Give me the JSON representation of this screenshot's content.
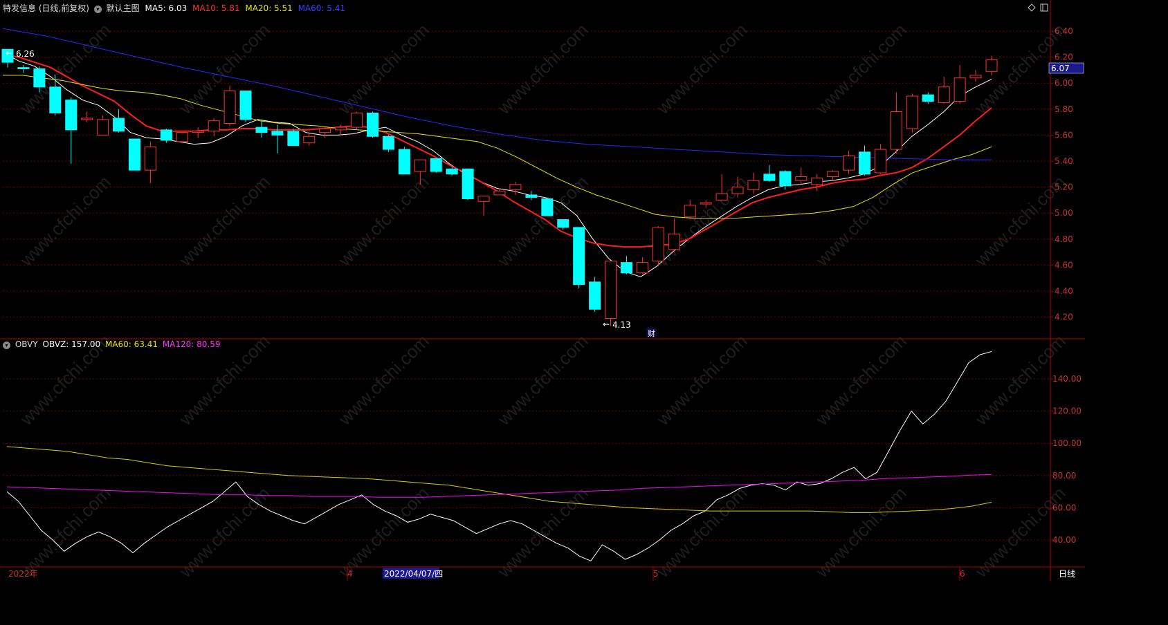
{
  "colors": {
    "up": "#ff3232",
    "down": "#00ffff",
    "ma5": "#ffffff",
    "ma10": "#ff1e1e",
    "ma20": "#e6e600",
    "ma60": "#2828ff",
    "grid": "#7a0000",
    "border": "#b40000",
    "obv": "#ffffff",
    "obv_ma60": "#d2d200",
    "obv_ma120": "#ff00ff"
  },
  "header": {
    "title": "特发信息 (日线,前复权)",
    "indicator_label": "默认主图",
    "ma5": "MA5: 6.03",
    "ma10": "MA10: 5.81",
    "ma20": "MA20: 5.51",
    "ma60": "MA60: 5.41"
  },
  "sub_header": {
    "title": "OBVY",
    "obvz": "OBVZ: 157.00",
    "ma60": "MA60: 63.41",
    "ma120": "MA120: 80.59"
  },
  "price_axis_labels": [
    "6.40",
    "6.20",
    "6.00",
    "5.80",
    "5.60",
    "5.40",
    "5.20",
    "5.00",
    "4.80",
    "4.60",
    "4.40",
    "4.20"
  ],
  "obv_axis_labels": [
    "140.00",
    "120.00",
    "100.00",
    "80.00",
    "60.00",
    "40.00"
  ],
  "last_price_tag": "6.07",
  "high_label": "6.26",
  "low_label": "4.13",
  "event_marker": "财",
  "x_labels": {
    "start": "2022年",
    "apr": "4",
    "cursor_date": "2022/04/07/四",
    "may": "5",
    "jun": "6"
  },
  "period_button": "日线",
  "watermark": "www.cfchi.com",
  "chart_data": [
    {
      "type": "candlestick",
      "title": "特发信息 (日线,前复权)",
      "ylim": [
        4.1,
        6.5
      ],
      "series_order": [
        "open",
        "close",
        "high",
        "low"
      ],
      "candles": [
        [
          6.26,
          6.16,
          6.26,
          6.12
        ],
        [
          6.12,
          6.11,
          6.14,
          6.08
        ],
        [
          6.11,
          5.97,
          6.13,
          5.93
        ],
        [
          5.97,
          5.77,
          6.06,
          5.75
        ],
        [
          5.87,
          5.64,
          5.89,
          5.38
        ],
        [
          5.72,
          5.73,
          5.78,
          5.7
        ],
        [
          5.6,
          5.72,
          5.75,
          5.6
        ],
        [
          5.73,
          5.63,
          5.8,
          5.62
        ],
        [
          5.57,
          5.33,
          5.57,
          5.33
        ],
        [
          5.33,
          5.51,
          5.55,
          5.23
        ],
        [
          5.64,
          5.56,
          5.65,
          5.54
        ],
        [
          5.55,
          5.62,
          5.62,
          5.55
        ],
        [
          5.62,
          5.63,
          5.66,
          5.58
        ],
        [
          5.63,
          5.71,
          5.73,
          5.59
        ],
        [
          5.69,
          5.94,
          5.98,
          5.67
        ],
        [
          5.94,
          5.72,
          5.94,
          5.7
        ],
        [
          5.66,
          5.62,
          5.72,
          5.58
        ],
        [
          5.63,
          5.6,
          5.68,
          5.46
        ],
        [
          5.63,
          5.52,
          5.65,
          5.52
        ],
        [
          5.54,
          5.59,
          5.61,
          5.52
        ],
        [
          5.62,
          5.65,
          5.66,
          5.58
        ],
        [
          5.64,
          5.66,
          5.68,
          5.6
        ],
        [
          5.66,
          5.77,
          5.78,
          5.64
        ],
        [
          5.77,
          5.59,
          5.78,
          5.58
        ],
        [
          5.59,
          5.49,
          5.6,
          5.47
        ],
        [
          5.49,
          5.3,
          5.51,
          5.3
        ],
        [
          5.32,
          5.41,
          5.41,
          5.22
        ],
        [
          5.42,
          5.32,
          5.42,
          5.31
        ],
        [
          5.34,
          5.3,
          5.36,
          5.29
        ],
        [
          5.34,
          5.11,
          5.34,
          5.1
        ],
        [
          5.09,
          5.13,
          5.13,
          4.98
        ],
        [
          5.14,
          5.17,
          5.19,
          5.14
        ],
        [
          5.18,
          5.22,
          5.24,
          5.14
        ],
        [
          5.14,
          5.12,
          5.17,
          5.1
        ],
        [
          5.11,
          4.98,
          5.12,
          4.98
        ],
        [
          4.95,
          4.89,
          4.95,
          4.87
        ],
        [
          4.89,
          4.45,
          4.89,
          4.42
        ],
        [
          4.47,
          4.26,
          4.51,
          4.24
        ],
        [
          4.19,
          4.63,
          4.63,
          4.13
        ],
        [
          4.62,
          4.54,
          4.67,
          4.53
        ],
        [
          4.54,
          4.62,
          4.66,
          4.53
        ],
        [
          4.63,
          4.89,
          4.9,
          4.59
        ],
        [
          4.72,
          4.84,
          4.96,
          4.7
        ],
        [
          4.97,
          5.06,
          5.1,
          4.95
        ],
        [
          5.07,
          5.08,
          5.1,
          5.04
        ],
        [
          5.1,
          5.15,
          5.3,
          5.1
        ],
        [
          5.15,
          5.2,
          5.28,
          5.12
        ],
        [
          5.18,
          5.25,
          5.31,
          5.15
        ],
        [
          5.3,
          5.25,
          5.37,
          5.24
        ],
        [
          5.32,
          5.21,
          5.33,
          5.18
        ],
        [
          5.25,
          5.28,
          5.35,
          5.22
        ],
        [
          5.22,
          5.27,
          5.3,
          5.17
        ],
        [
          5.28,
          5.32,
          5.33,
          5.25
        ],
        [
          5.33,
          5.44,
          5.48,
          5.3
        ],
        [
          5.47,
          5.3,
          5.52,
          5.29
        ],
        [
          5.31,
          5.49,
          5.53,
          5.3
        ],
        [
          5.49,
          5.78,
          5.93,
          5.46
        ],
        [
          5.65,
          5.9,
          5.92,
          5.62
        ],
        [
          5.91,
          5.86,
          5.93,
          5.84
        ],
        [
          5.85,
          5.97,
          6.05,
          5.84
        ],
        [
          5.86,
          6.04,
          6.14,
          5.84
        ],
        [
          6.04,
          6.06,
          6.1,
          6.01
        ],
        [
          6.09,
          6.18,
          6.21,
          6.06
        ]
      ],
      "series": [
        {
          "name": "MA5",
          "values": [
            6.24,
            6.17,
            6.13,
            6.05,
            5.95,
            5.87,
            5.83,
            5.74,
            5.62,
            5.58,
            5.57,
            5.55,
            5.53,
            5.54,
            5.59,
            5.67,
            5.72,
            5.7,
            5.69,
            5.62,
            5.6,
            5.6,
            5.61,
            5.64,
            5.66,
            5.6,
            5.55,
            5.48,
            5.38,
            5.3,
            5.24,
            5.19,
            5.17,
            5.14,
            5.12,
            5.08,
            4.98,
            4.8,
            4.65,
            4.55,
            4.51,
            4.59,
            4.7,
            4.8,
            4.89,
            4.97,
            5.05,
            5.12,
            5.18,
            5.21,
            5.22,
            5.24,
            5.25,
            5.27,
            5.3,
            5.36,
            5.47,
            5.59,
            5.68,
            5.78,
            5.9,
            5.97,
            6.03
          ]
        },
        {
          "name": "MA10",
          "values": [
            6.22,
            6.2,
            6.16,
            6.12,
            6.05,
            5.98,
            5.92,
            5.86,
            5.76,
            5.67,
            5.63,
            5.63,
            5.63,
            5.64,
            5.64,
            5.65,
            5.65,
            5.64,
            5.64,
            5.64,
            5.65,
            5.66,
            5.67,
            5.66,
            5.62,
            5.56,
            5.5,
            5.44,
            5.37,
            5.31,
            5.24,
            5.17,
            5.09,
            5.02,
            4.95,
            4.86,
            4.81,
            4.77,
            4.75,
            4.74,
            4.74,
            4.75,
            4.76,
            4.8,
            4.87,
            4.94,
            5.01,
            5.08,
            5.12,
            5.15,
            5.18,
            5.2,
            5.23,
            5.25,
            5.26,
            5.29,
            5.31,
            5.35,
            5.42,
            5.51,
            5.6,
            5.71,
            5.81
          ]
        },
        {
          "name": "MA20",
          "values": [
            6.06,
            6.06,
            6.04,
            6.02,
            5.99,
            5.96,
            5.94,
            5.93,
            5.91,
            5.88,
            5.83,
            5.79,
            5.75,
            5.71,
            5.69,
            5.68,
            5.67,
            5.65,
            5.64,
            5.63,
            5.62,
            5.61,
            5.59,
            5.57,
            5.55,
            5.5,
            5.43,
            5.35,
            5.27,
            5.2,
            5.14,
            5.09,
            5.04,
            4.99,
            4.97,
            4.96,
            4.96,
            4.96,
            4.97,
            4.98,
            4.99,
            5.0,
            5.02,
            5.05,
            5.12,
            5.22,
            5.31,
            5.36,
            5.41,
            5.45,
            5.51
          ]
        },
        {
          "name": "MA60",
          "values": [
            6.42,
            6.36,
            6.28,
            6.2,
            6.12,
            6.05,
            5.98,
            5.9,
            5.82,
            5.74,
            5.67,
            5.61,
            5.56,
            5.53,
            5.51,
            5.49,
            5.47,
            5.45,
            5.44,
            5.43,
            5.42,
            5.41,
            5.41
          ]
        }
      ]
    },
    {
      "type": "line",
      "title": "OBVY",
      "ylim": [
        33,
        160
      ],
      "series": [
        {
          "name": "OBVZ",
          "values": [
            70,
            64,
            55,
            46,
            40,
            33,
            38,
            42,
            45,
            42,
            38,
            32,
            38,
            43,
            48,
            52,
            56,
            60,
            64,
            70,
            76,
            67,
            62,
            58,
            55,
            52,
            50,
            54,
            58,
            62,
            65,
            68,
            62,
            58,
            55,
            51,
            53,
            56,
            54,
            52,
            48,
            44,
            47,
            50,
            52,
            50,
            46,
            42,
            38,
            35,
            30,
            27,
            37,
            33,
            28,
            31,
            35,
            40,
            46,
            50,
            55,
            58,
            65,
            68,
            72,
            74,
            75,
            74,
            71,
            76,
            74,
            75,
            78,
            82,
            85,
            78,
            82,
            95,
            108,
            120,
            112,
            118,
            126,
            138,
            150,
            155,
            157
          ]
        },
        {
          "name": "MA60",
          "values": [
            98,
            97,
            96,
            95,
            93,
            91,
            90,
            88,
            86,
            85,
            84,
            83,
            82,
            81,
            80,
            79.5,
            79,
            78.5,
            78,
            77,
            76,
            75,
            74,
            72,
            70,
            68,
            66,
            64,
            63,
            62,
            61,
            60,
            59.5,
            59,
            58.5,
            58,
            58,
            58,
            58,
            58,
            58,
            57.5,
            57,
            57,
            57.5,
            58,
            58.5,
            59.5,
            61,
            63.4
          ]
        },
        {
          "name": "MA120",
          "values": [
            73,
            72.5,
            72,
            71.5,
            71,
            70.5,
            70,
            69.5,
            69,
            68.5,
            68,
            68,
            67.5,
            67.5,
            67,
            67,
            67,
            66.5,
            66.5,
            66.5,
            67,
            67.5,
            68,
            68.5,
            69,
            69.5,
            70,
            70.5,
            71,
            72,
            72.5,
            73,
            73.5,
            74,
            74.5,
            75,
            75.5,
            76,
            76.5,
            77,
            78,
            78.5,
            79,
            79.5,
            80.2,
            80.59
          ]
        }
      ]
    }
  ]
}
